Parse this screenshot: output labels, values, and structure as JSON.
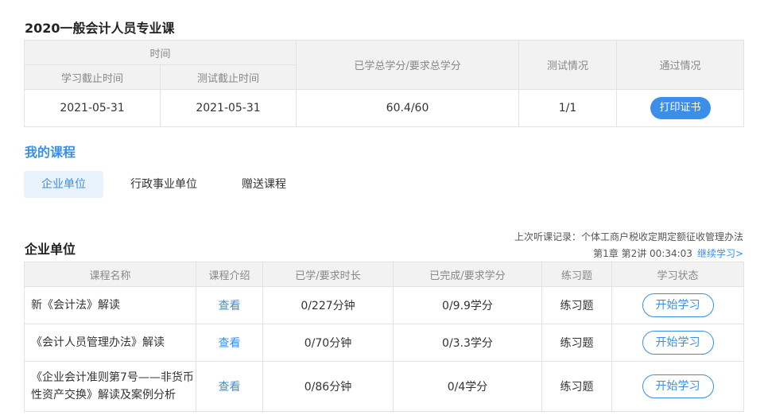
{
  "course_title": "2020一般会计人员专业课",
  "summary": {
    "header_time": "时间",
    "header_study_deadline": "学习截止时间",
    "header_test_deadline": "测试截止时间",
    "header_credits": "已学总学分/要求总学分",
    "header_test_status": "测试情况",
    "header_pass_status": "通过情况",
    "study_deadline": "2021-05-31",
    "test_deadline": "2021-05-31",
    "credits": "60.4/60",
    "test_status": "1/1",
    "print_button": "打印证书"
  },
  "my_course_title": "我的课程",
  "tabs": [
    {
      "label": "企业单位",
      "active": true
    },
    {
      "label": "行政事业单位",
      "active": false
    },
    {
      "label": "赠送课程",
      "active": false
    }
  ],
  "section_title": "企业单位",
  "last_record": {
    "line1": "上次听课记录：个体工商户税收定期定额征收管理办法",
    "line2": "第1章  第2讲  00:34:03",
    "continue_label": "继续学习>"
  },
  "course_table": {
    "headers": [
      "课程名称",
      "课程介绍",
      "已学/要求时长",
      "已完成/要求学分",
      "练习题",
      "学习状态"
    ],
    "rows": [
      {
        "name": "新《会计法》解读",
        "intro": "查看",
        "duration": "0/227分钟",
        "credits": "0/9.9学分",
        "exercise": "练习题",
        "action": "开始学习"
      },
      {
        "name": "《会计人员管理办法》解读",
        "intro": "查看",
        "duration": "0/70分钟",
        "credits": "0/3.3学分",
        "exercise": "练习题",
        "action": "开始学习"
      },
      {
        "name": "《企业会计准则第7号——非货币性资产交换》解读及案例分析",
        "intro": "查看",
        "duration": "0/86分钟",
        "credits": "0/4学分",
        "exercise": "练习题",
        "action": "开始学习"
      }
    ]
  }
}
